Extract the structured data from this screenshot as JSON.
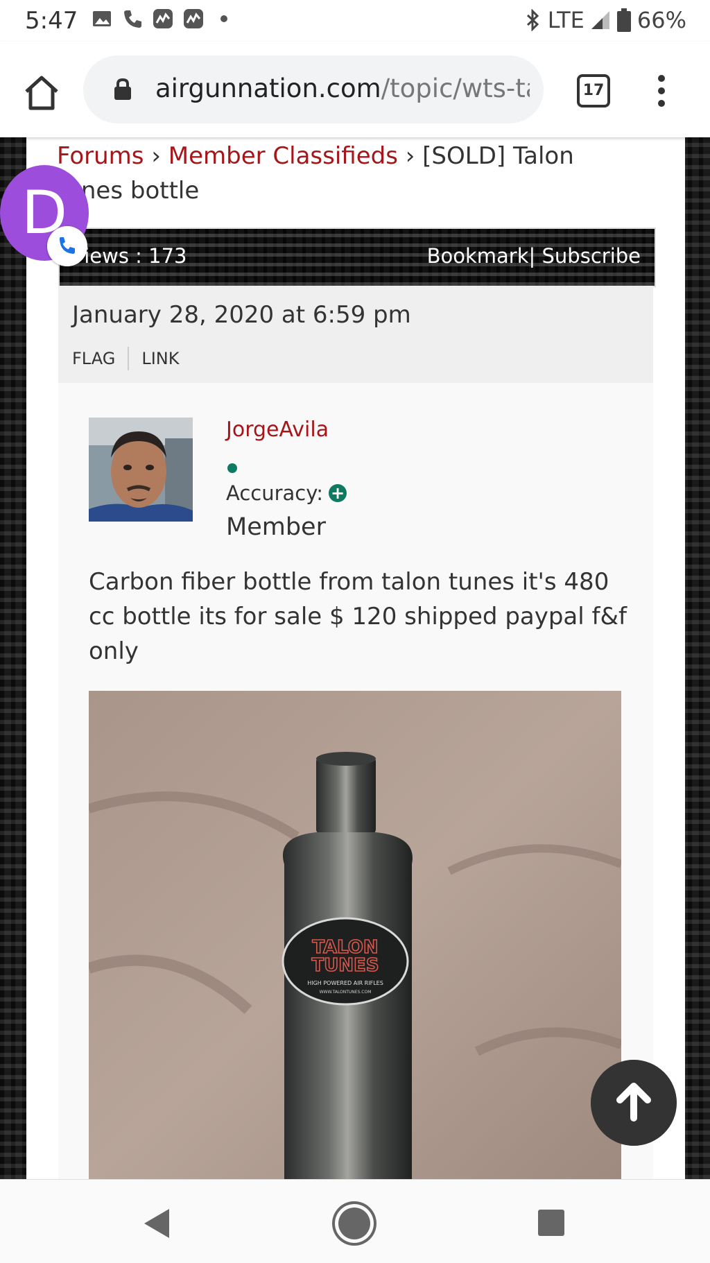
{
  "status_bar": {
    "time": "5:47",
    "network": "LTE",
    "battery": "66%",
    "icons": [
      "image-icon",
      "phone-icon",
      "analytics-icon",
      "analytics-icon",
      "dot-icon",
      "bluetooth-icon",
      "signal-icon",
      "battery-icon"
    ]
  },
  "browser": {
    "url_domain": "airgunnation.com",
    "url_path": "/topic/wts-ta",
    "tab_count": "17"
  },
  "breadcrumb": {
    "items": [
      "Forums",
      "Member Classifieds"
    ],
    "separator": "›",
    "current": "[SOLD] Talon tunes bottle"
  },
  "topic_stats": {
    "views": "Views : 173",
    "bookmark": "Bookmark",
    "separator": "|",
    "subscribe": "Subscribe"
  },
  "post": {
    "date": "January 28, 2020 at 6:59 pm",
    "flag": "FLAG",
    "link": "LINK",
    "author": "JorgeAvila",
    "accuracy_label": "Accuracy:",
    "role": "Member",
    "text": "Carbon fiber bottle from talon tunes it's 480 cc bottle its for sale $ 120 shipped paypal f&f only"
  },
  "photo_label": {
    "line1": "TALON",
    "line2": "TUNES",
    "line3": "HIGH POWERED AIR RIFLES",
    "line4": "WWW.TALONTUNES.COM"
  },
  "contact_bubble": {
    "initial": "D",
    "color": "#9c4ddb"
  },
  "colors": {
    "link_red": "#a4161a",
    "accent_green": "#0f7a62"
  }
}
